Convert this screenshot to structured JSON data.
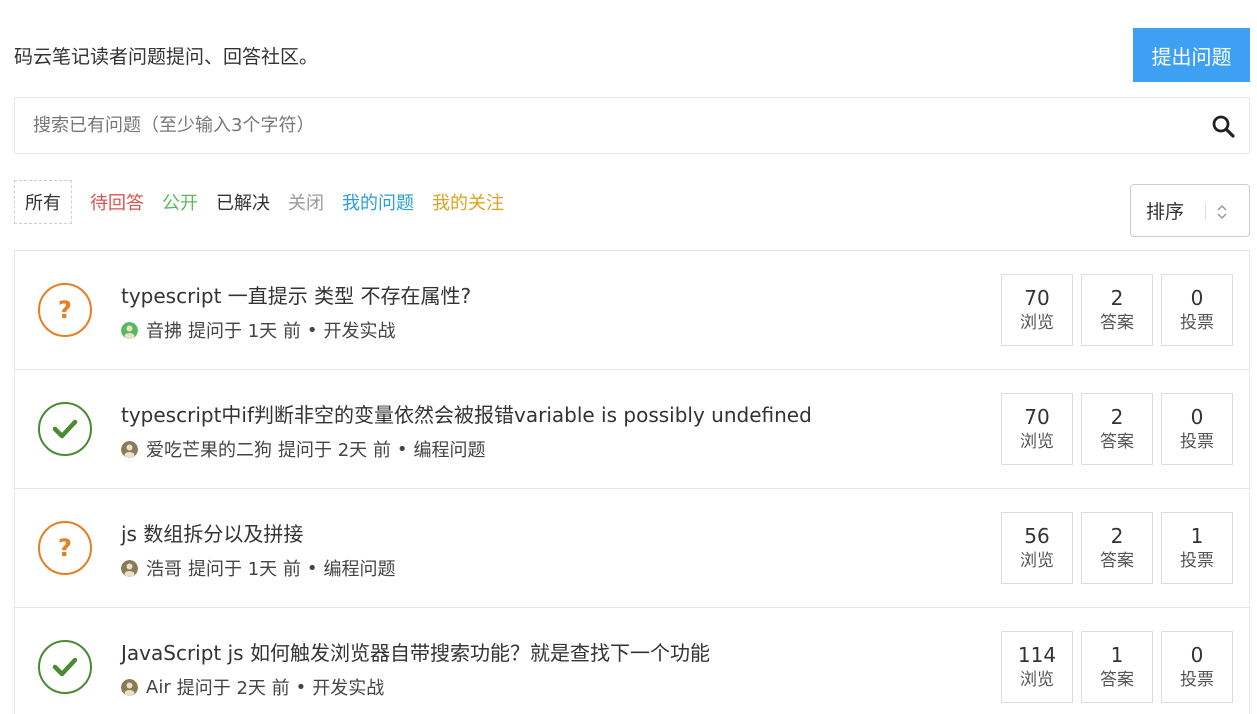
{
  "header": {
    "intro": "码云笔记读者问题提问、回答社区。",
    "ask_button": "提出问题"
  },
  "search": {
    "placeholder": "搜索已有问题（至少输入3个字符）",
    "icon": "search-icon"
  },
  "filters": [
    {
      "label": "所有",
      "color": "#333333",
      "active": true
    },
    {
      "label": "待回答",
      "color": "#d9534f",
      "active": false
    },
    {
      "label": "公开",
      "color": "#5cb85c",
      "active": false
    },
    {
      "label": "已解决",
      "color": "#333333",
      "active": false
    },
    {
      "label": "关闭",
      "color": "#999999",
      "active": false
    },
    {
      "label": "我的问题",
      "color": "#2a9fd6",
      "active": false
    },
    {
      "label": "我的关注",
      "color": "#d9a520",
      "active": false
    }
  ],
  "sort": {
    "label": "排序"
  },
  "questions": [
    {
      "status": "open",
      "title": "typescript 一直提示 类型 不存在属性?",
      "author": "音拂",
      "asked": "提问于 1天 前",
      "bullet": "•",
      "category": "开发实战",
      "avatar_color": "#5cb85c",
      "views": "70",
      "views_label": "浏览",
      "answers": "2",
      "answers_label": "答案",
      "votes": "0",
      "votes_label": "投票"
    },
    {
      "status": "solved",
      "title": "typescript中if判断非空的变量依然会被报错variable is possibly undefined",
      "author": "爱吃芒果的二狗",
      "asked": "提问于 2天 前",
      "bullet": "•",
      "category": "编程问题",
      "avatar_color": "#8a7a5a",
      "views": "70",
      "views_label": "浏览",
      "answers": "2",
      "answers_label": "答案",
      "votes": "0",
      "votes_label": "投票"
    },
    {
      "status": "open",
      "title": "js 数组拆分以及拼接",
      "author": "浩哥",
      "asked": "提问于 1天 前",
      "bullet": "•",
      "category": "编程问题",
      "avatar_color": "#8a7a5a",
      "views": "56",
      "views_label": "浏览",
      "answers": "2",
      "answers_label": "答案",
      "votes": "1",
      "votes_label": "投票"
    },
    {
      "status": "solved",
      "title": "JavaScript js 如何触发浏览器自带搜索功能？就是查找下一个功能",
      "author": "Air",
      "asked": "提问于 2天 前",
      "bullet": "•",
      "category": "开发实战",
      "avatar_color": "#8a7a5a",
      "views": "114",
      "views_label": "浏览",
      "answers": "1",
      "answers_label": "答案",
      "votes": "0",
      "votes_label": "投票"
    }
  ]
}
